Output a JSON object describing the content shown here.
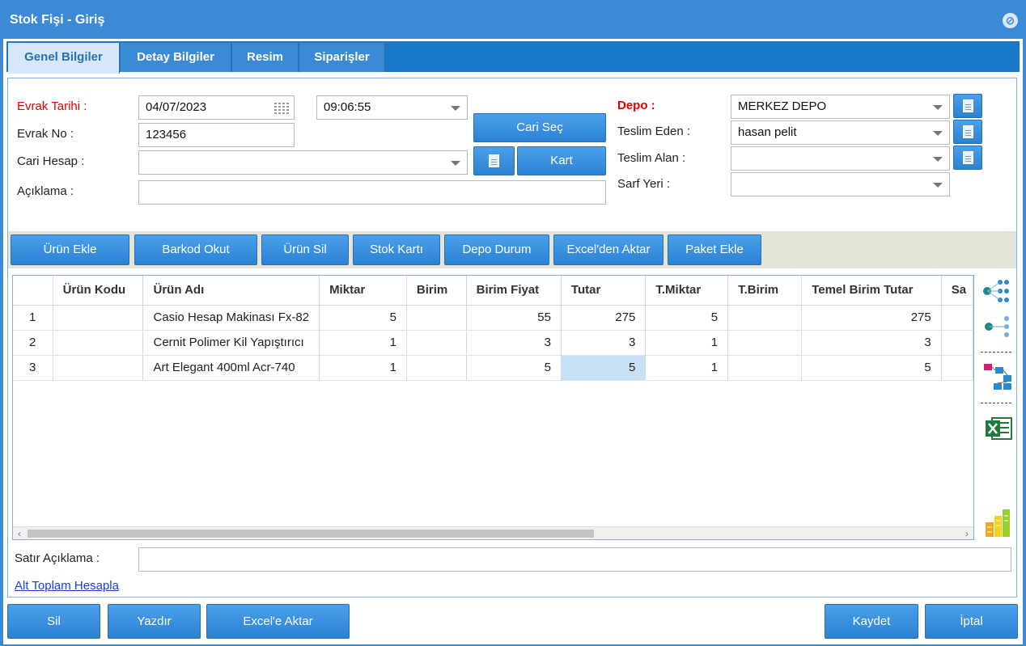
{
  "window": {
    "title": "Stok Fişi - Giriş"
  },
  "tabs": [
    {
      "label": "Genel Bilgiler"
    },
    {
      "label": "Detay Bilgiler"
    },
    {
      "label": "Resim"
    },
    {
      "label": "Siparişler"
    }
  ],
  "form": {
    "evrak_tarihi_label": "Evrak Tarihi :",
    "evrak_tarihi_value": "04/07/2023",
    "time_value": "09:06:55",
    "evrak_no_label": "Evrak No :",
    "evrak_no_value": "123456",
    "cari_hesap_label": "Cari Hesap :",
    "cari_hesap_value": "",
    "aciklama_label": "Açıklama :",
    "aciklama_value": "",
    "cari_sec_label": "Cari Seç",
    "kart_label": "Kart",
    "depo_label": "Depo :",
    "depo_value": "MERKEZ DEPO",
    "teslim_eden_label": "Teslim Eden :",
    "teslim_eden_value": "hasan pelit",
    "teslim_alan_label": "Teslim Alan :",
    "teslim_alan_value": "",
    "sarf_yeri_label": "Sarf Yeri :",
    "sarf_yeri_value": ""
  },
  "toolbar": [
    {
      "label": "Ürün Ekle"
    },
    {
      "label": "Barkod Okut"
    },
    {
      "label": "Ürün Sil"
    },
    {
      "label": "Stok Kartı"
    },
    {
      "label": "Depo Durum"
    },
    {
      "label": "Excel'den Aktar"
    },
    {
      "label": "Paket Ekle"
    }
  ],
  "grid": {
    "columns": [
      "",
      "Ürün Kodu",
      "Ürün Adı",
      "Miktar",
      "Birim",
      "Birim Fiyat",
      "Tutar",
      "T.Miktar",
      "T.Birim",
      "Temel Birim Tutar",
      "Sa"
    ],
    "rows": [
      [
        "1",
        "",
        "Casio Hesap Makinası Fx-82",
        "5",
        "",
        "55",
        "275",
        "5",
        "",
        "275",
        ""
      ],
      [
        "2",
        "",
        "Cernit Polimer Kil Yapıştırıcı",
        "1",
        "",
        "3",
        "3",
        "1",
        "",
        "3",
        ""
      ],
      [
        "3",
        "",
        "Art Elegant 400ml Acr-740",
        "1",
        "",
        "5",
        "5",
        "1",
        "",
        "5",
        ""
      ]
    ]
  },
  "satir_aciklama_label": "Satır Açıklama :",
  "satir_aciklama_value": "",
  "alt_toplam_link": "Alt Toplam Hesapla",
  "footer": {
    "sil": "Sil",
    "yazdir": "Yazdır",
    "excel_aktar": "Excel'e Aktar",
    "kaydet": "Kaydet",
    "iptal": "İptal"
  },
  "colors": {
    "accent": "#3a8ad6",
    "tab_active_bg": "#d6e8f8",
    "required_label": "#e00000",
    "selected_cell": "#c6e0f6"
  }
}
